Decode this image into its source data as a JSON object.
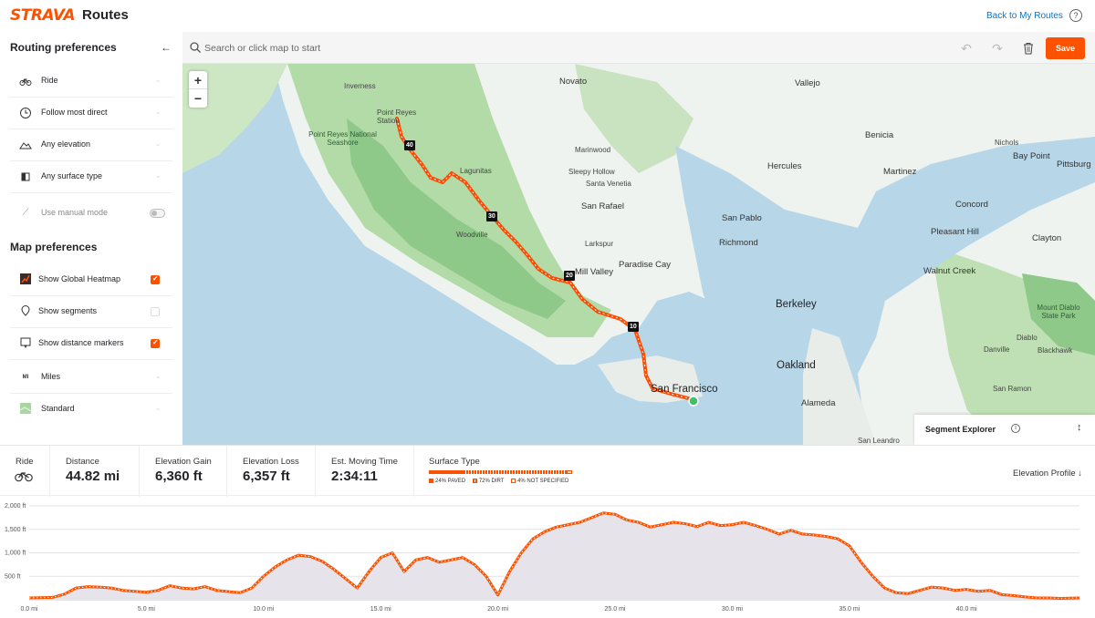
{
  "header": {
    "logo": "STRAVA",
    "title": "Routes",
    "back_link": "Back to My Routes",
    "help_icon": "help-icon"
  },
  "search": {
    "placeholder": "Search or click map to start",
    "value": ""
  },
  "toolbar": {
    "save_label": "Save",
    "undo_icon": "undo-icon",
    "redo_icon": "redo-icon",
    "trash_icon": "trash-icon"
  },
  "sidebar": {
    "routing_title": "Routing preferences",
    "routing": [
      {
        "label": "Ride",
        "icon": "bike-icon"
      },
      {
        "label": "Follow most direct",
        "icon": "clock-icon"
      },
      {
        "label": "Any elevation",
        "icon": "elevation-icon"
      },
      {
        "label": "Any surface type",
        "icon": "surface-icon"
      }
    ],
    "manual_mode": {
      "label": "Use manual mode",
      "enabled": false
    },
    "map_title": "Map preferences",
    "map_prefs": [
      {
        "label": "Show Global Heatmap",
        "checked": true
      },
      {
        "label": "Show segments",
        "checked": false
      },
      {
        "label": "Show distance markers",
        "checked": true
      }
    ],
    "units": {
      "label": "Miles",
      "icon_text": "MI"
    },
    "map_style": {
      "label": "Standard"
    }
  },
  "map": {
    "labels": [
      {
        "id": "inverness",
        "text": "Inverness"
      },
      {
        "id": "novato",
        "text": "Novato"
      },
      {
        "id": "vallejo",
        "text": "Vallejo"
      },
      {
        "id": "point-reyes-station",
        "text": "Point Reyes Station"
      },
      {
        "id": "point-reyes-ns",
        "text": "Point Reyes National Seashore"
      },
      {
        "id": "marinwood",
        "text": "Marinwood"
      },
      {
        "id": "benicia",
        "text": "Benicia"
      },
      {
        "id": "nichols",
        "text": "Nichols"
      },
      {
        "id": "bay-point",
        "text": "Bay Point"
      },
      {
        "id": "pittsburg",
        "text": "Pittsburg"
      },
      {
        "id": "lagunitas",
        "text": "Lagunitas"
      },
      {
        "id": "sleepy-hollow",
        "text": "Sleepy Hollow"
      },
      {
        "id": "hercules",
        "text": "Hercules"
      },
      {
        "id": "martinez",
        "text": "Martinez"
      },
      {
        "id": "santa-venetia",
        "text": "Santa Venetia"
      },
      {
        "id": "san-rafael",
        "text": "San Rafael"
      },
      {
        "id": "concord",
        "text": "Concord"
      },
      {
        "id": "san-pablo",
        "text": "San Pablo"
      },
      {
        "id": "woodville",
        "text": "Woodville"
      },
      {
        "id": "pleasant-hill",
        "text": "Pleasant Hill"
      },
      {
        "id": "clayton",
        "text": "Clayton"
      },
      {
        "id": "richmond",
        "text": "Richmond"
      },
      {
        "id": "larkspur",
        "text": "Larkspur"
      },
      {
        "id": "paradise-cay",
        "text": "Paradise Cay"
      },
      {
        "id": "mill-valley",
        "text": "Mill Valley"
      },
      {
        "id": "walnut-creek",
        "text": "Walnut Creek"
      },
      {
        "id": "berkeley",
        "text": "Berkeley"
      },
      {
        "id": "mount-diablo",
        "text": "Mount Diablo State Park"
      },
      {
        "id": "diablo",
        "text": "Diablo"
      },
      {
        "id": "danville",
        "text": "Danville"
      },
      {
        "id": "blackhawk",
        "text": "Blackhawk"
      },
      {
        "id": "oakland",
        "text": "Oakland"
      },
      {
        "id": "san-francisco",
        "text": "San Francisco"
      },
      {
        "id": "alameda",
        "text": "Alameda"
      },
      {
        "id": "san-ramon",
        "text": "San Ramon"
      },
      {
        "id": "san-leandro",
        "text": "San Leandro"
      }
    ],
    "distance_markers": [
      "40",
      "30",
      "20",
      "10"
    ],
    "zoom_in": "+",
    "zoom_out": "−",
    "segment_explorer": "Segment Explorer",
    "route_color": "#fc4c02"
  },
  "stats": {
    "ride_label": "Ride",
    "distance": {
      "label": "Distance",
      "value": "44.82 mi"
    },
    "elevation_gain": {
      "label": "Elevation Gain",
      "value": "6,360 ft"
    },
    "elevation_loss": {
      "label": "Elevation Loss",
      "value": "6,357 ft"
    },
    "moving_time": {
      "label": "Est. Moving Time",
      "value": "2:34:11"
    },
    "surface": {
      "label": "Surface Type",
      "paved": "24% PAVED",
      "dirt": "72% DIRT",
      "not_specified": "4% NOT SPECIFIED",
      "paved_pct": 24,
      "dirt_pct": 72,
      "na_pct": 4
    },
    "elevation_profile_btn": "Elevation Profile ↓"
  },
  "chart_data": {
    "type": "area",
    "x_unit": "mi",
    "y_unit": "ft",
    "xlim": [
      0,
      44.82
    ],
    "ylim": [
      0,
      2000
    ],
    "yticks": [
      "2,000 ft",
      "1,500 ft",
      "1,000 ft",
      "500 ft"
    ],
    "xticks": [
      "0.0 mi",
      "5.0 mi",
      "10.0 mi",
      "15.0 mi",
      "20.0 mi",
      "25.0 mi",
      "30.0 mi",
      "35.0 mi",
      "40.0 mi"
    ],
    "x": [
      0,
      1,
      1.5,
      2,
      2.5,
      3,
      3.5,
      4,
      5,
      5.5,
      6,
      6.5,
      7,
      7.5,
      8,
      9,
      9.5,
      10,
      10.5,
      11,
      11.5,
      12,
      12.5,
      13,
      13.5,
      14,
      14.5,
      15,
      15.5,
      16,
      16.5,
      17,
      17.5,
      18,
      18.5,
      19,
      19.5,
      20,
      20.5,
      21,
      21.5,
      22,
      22.5,
      23,
      23.5,
      24,
      24.5,
      25,
      25.5,
      26,
      26.5,
      27,
      27.5,
      28,
      28.5,
      29,
      29.5,
      30,
      30.5,
      31,
      31.5,
      32,
      32.5,
      33,
      33.5,
      34,
      34.5,
      35,
      35.5,
      36,
      36.5,
      37,
      37.5,
      38,
      38.5,
      39,
      39.5,
      40,
      40.5,
      41,
      41.5,
      42,
      42.5,
      43,
      43.5,
      44,
      44.82
    ],
    "values": [
      40,
      50,
      120,
      250,
      280,
      270,
      250,
      200,
      160,
      200,
      300,
      250,
      230,
      280,
      200,
      150,
      250,
      500,
      700,
      850,
      950,
      920,
      820,
      650,
      450,
      250,
      600,
      900,
      1000,
      600,
      850,
      900,
      800,
      850,
      900,
      750,
      500,
      100,
      600,
      1000,
      1300,
      1450,
      1550,
      1600,
      1650,
      1750,
      1850,
      1820,
      1700,
      1650,
      1550,
      1600,
      1650,
      1620,
      1560,
      1650,
      1580,
      1600,
      1650,
      1580,
      1500,
      1400,
      1480,
      1400,
      1380,
      1350,
      1300,
      1150,
      800,
      500,
      250,
      150,
      130,
      200,
      270,
      250,
      200,
      220,
      180,
      200,
      110,
      90,
      60,
      40,
      40,
      30,
      40
    ]
  }
}
